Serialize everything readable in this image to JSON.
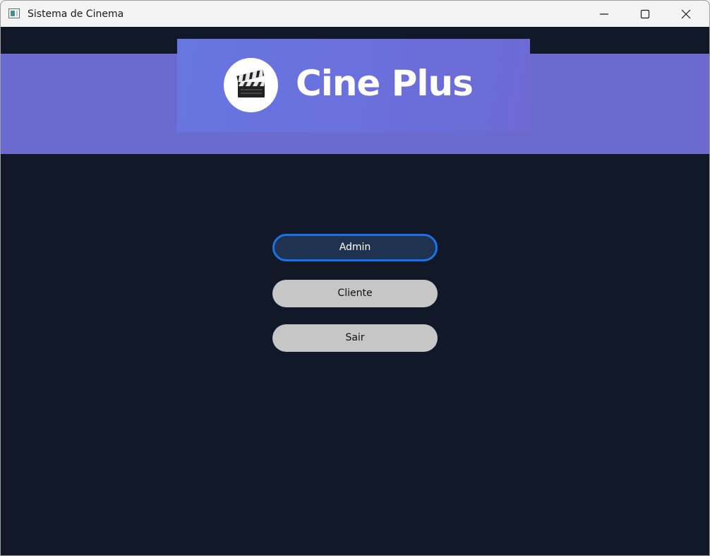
{
  "window": {
    "title": "Sistema de Cinema",
    "controls": {
      "minimize_icon": "minimize-icon",
      "maximize_icon": "maximize-icon",
      "close_icon": "close-icon"
    }
  },
  "header": {
    "logo_icon": "clapperboard-icon",
    "brand_name": "Cine Plus",
    "band_color": "#6b6bcf",
    "banner_color": "#6a70dc"
  },
  "menu": {
    "admin_label": "Admin",
    "cliente_label": "Cliente",
    "sair_label": "Sair",
    "focus_color": "#1a73e8"
  },
  "colors": {
    "background": "#111827",
    "button": "#c6c6c6"
  }
}
